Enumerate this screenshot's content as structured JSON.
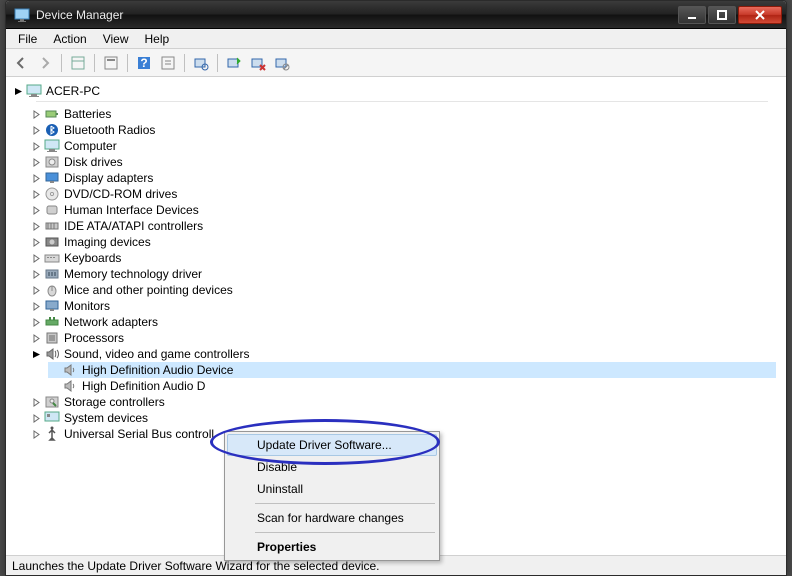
{
  "window": {
    "title": "Device Manager"
  },
  "menu": {
    "file": "File",
    "action": "Action",
    "view": "View",
    "help": "Help"
  },
  "tree": {
    "root": "ACER-PC",
    "categories": [
      {
        "label": "Batteries",
        "icon": "battery"
      },
      {
        "label": "Bluetooth Radios",
        "icon": "bluetooth"
      },
      {
        "label": "Computer",
        "icon": "computer"
      },
      {
        "label": "Disk drives",
        "icon": "disk"
      },
      {
        "label": "Display adapters",
        "icon": "display"
      },
      {
        "label": "DVD/CD-ROM drives",
        "icon": "cd"
      },
      {
        "label": "Human Interface Devices",
        "icon": "hid"
      },
      {
        "label": "IDE ATA/ATAPI controllers",
        "icon": "ide"
      },
      {
        "label": "Imaging devices",
        "icon": "image"
      },
      {
        "label": "Keyboards",
        "icon": "keyboard"
      },
      {
        "label": "Memory technology driver",
        "icon": "memory"
      },
      {
        "label": "Mice and other pointing devices",
        "icon": "mouse"
      },
      {
        "label": "Monitors",
        "icon": "monitor"
      },
      {
        "label": "Network adapters",
        "icon": "net"
      },
      {
        "label": "Processors",
        "icon": "cpu"
      },
      {
        "label": "Sound, video and game controllers",
        "icon": "sound",
        "expanded": true,
        "children": [
          {
            "label": "High Definition Audio Device",
            "icon": "speaker",
            "selected": true
          },
          {
            "label": "High Definition Audio D",
            "icon": "speaker"
          }
        ]
      },
      {
        "label": "Storage controllers",
        "icon": "storage"
      },
      {
        "label": "System devices",
        "icon": "system"
      },
      {
        "label": "Universal Serial Bus controll",
        "icon": "usb"
      }
    ]
  },
  "context_menu": {
    "items": [
      {
        "label": "Update Driver Software...",
        "highlight": true
      },
      {
        "label": "Disable"
      },
      {
        "label": "Uninstall"
      },
      {
        "sep": true
      },
      {
        "label": "Scan for hardware changes"
      },
      {
        "sep": true
      },
      {
        "label": "Properties",
        "bold": true
      }
    ]
  },
  "statusbar": "Launches the Update Driver Software Wizard for the selected device."
}
